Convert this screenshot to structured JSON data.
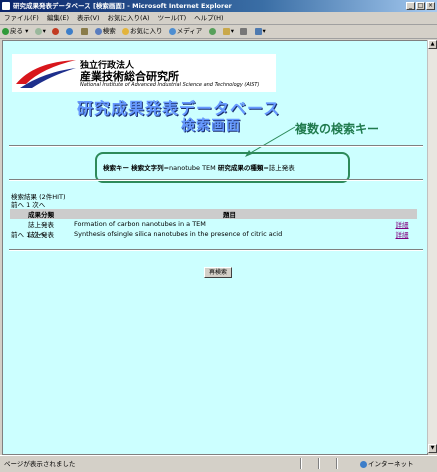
{
  "window": {
    "title": "研究成果発表データベース [検索画面] - Microsoft Internet Explorer"
  },
  "menu": [
    "ファイル(F)",
    "編集(E)",
    "表示(V)",
    "お気に入り(A)",
    "ツール(T)",
    "ヘルプ(H)"
  ],
  "toolbar": {
    "back": "戻る",
    "search": "検索",
    "favorites": "お気に入り",
    "media": "メディア"
  },
  "page": {
    "org_small": "独立行政法人",
    "org_name": "産業技術総合研究所",
    "org_english": "National Institute of Advanced Industrial Science and Technology (AIST)",
    "title_line1": "研究成果発表データベース",
    "title_line2": "検索画面",
    "callout": "複数の検索キー",
    "search_key_label": "検索キー",
    "search_string_label": "検索文字列",
    "search_string_value": "=nanotube TEM",
    "category_label": "研究成果の種類",
    "category_value": "=誌上発表",
    "result_count": "検索結果 (2件HIT)",
    "pager_top": "前へ  1  次へ",
    "pager_bottom": "前へ  1  次へ",
    "table": {
      "headers": [
        "成果分類",
        "題目",
        ""
      ],
      "rows": [
        {
          "category": "誌上発表",
          "title": "Formation of carbon nanotubes in a TEM",
          "detail": "詳細"
        },
        {
          "category": "誌上発表",
          "title": "Synthesis ofsingle silica nanotubes in the presence of citric acid",
          "detail": "詳細"
        }
      ]
    },
    "search_again": "再検索"
  },
  "status": {
    "left": "ページが表示されました",
    "zone": "インターネット"
  }
}
